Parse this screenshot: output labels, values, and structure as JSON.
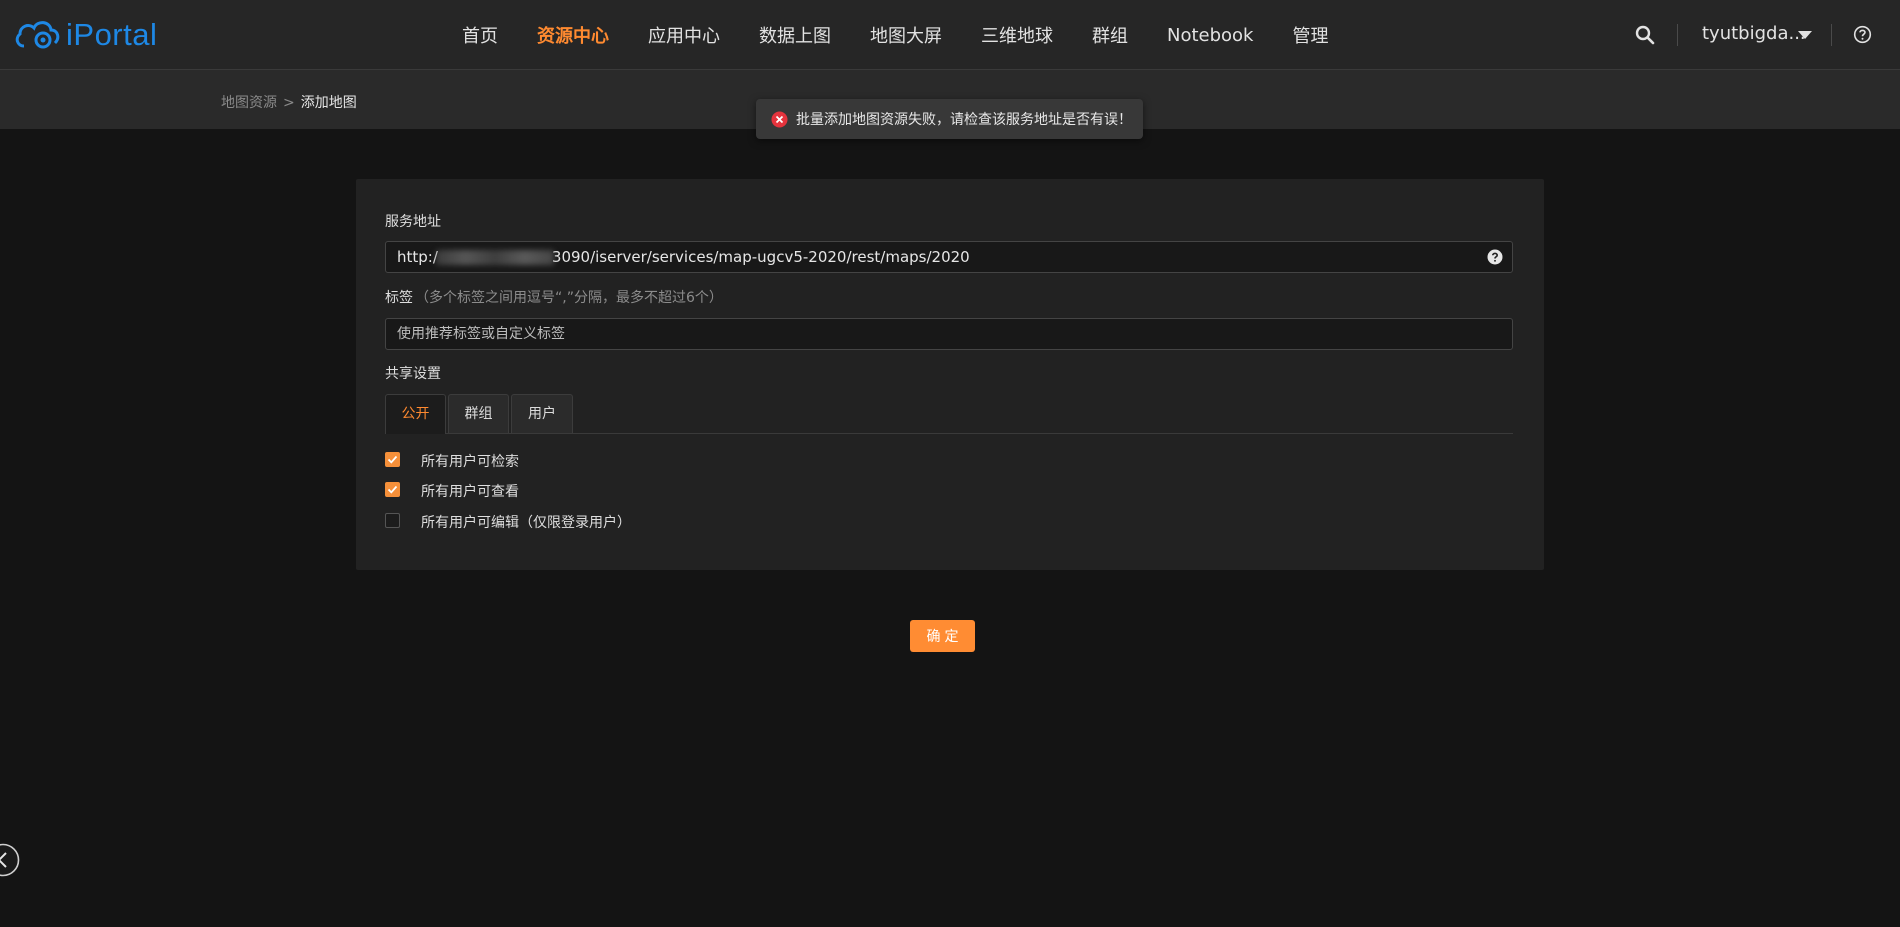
{
  "header": {
    "logo_text": "iPortal",
    "menu": [
      {
        "label": "首页",
        "active": false
      },
      {
        "label": "资源中心",
        "active": true
      },
      {
        "label": "应用中心",
        "active": false
      },
      {
        "label": "数据上图",
        "active": false
      },
      {
        "label": "地图大屏",
        "active": false
      },
      {
        "label": "三维地球",
        "active": false
      },
      {
        "label": "群组",
        "active": false
      },
      {
        "label": "Notebook",
        "active": false
      },
      {
        "label": "管理",
        "active": false
      }
    ],
    "username": "tyutbigda...",
    "icons": {
      "search": "search-icon",
      "help": "help-icon",
      "user_menu": "caret-down-icon"
    }
  },
  "breadcrumb": {
    "parent": "地图资源",
    "separator": ">",
    "current": "添加地图"
  },
  "toast": {
    "type": "error",
    "message": "批量添加地图资源失败，请检查该服务地址是否有误！"
  },
  "form": {
    "service_label": "服务地址",
    "service_url_prefix": "http:/",
    "service_url_suffix": "3090/iserver/services/map-ugcv5-2020/rest/maps/2020",
    "tags_label": "标签",
    "tags_hint": "（多个标签之间用逗号“,”分隔，最多不超过6个）",
    "tags_placeholder": "使用推荐标签或自定义标签",
    "share_label": "共享设置",
    "tabs": [
      {
        "label": "公开",
        "active": true
      },
      {
        "label": "群组",
        "active": false
      },
      {
        "label": "用户",
        "active": false
      }
    ],
    "permissions": [
      {
        "label": "所有用户可检索",
        "checked": true
      },
      {
        "label": "所有用户可查看",
        "checked": true
      },
      {
        "label": "所有用户可编辑（仅限登录用户）",
        "checked": false
      }
    ],
    "submit_label": "确定"
  },
  "colors": {
    "accent": "#ff8c33",
    "error": "#e5333d",
    "brand": "#1e88e5"
  }
}
